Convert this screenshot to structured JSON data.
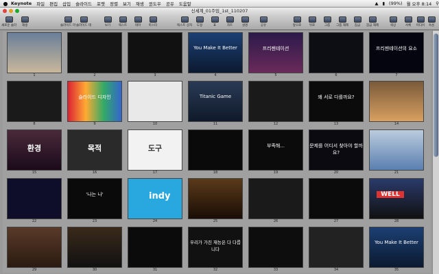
{
  "menubar": {
    "apple": "",
    "app_name": "Keynote",
    "menus": [
      "파일",
      "편집",
      "삽입",
      "슬라이드",
      "포맷",
      "정렬",
      "보기",
      "재생",
      "윈도우",
      "공유",
      "도움말"
    ],
    "battery": "(99%)",
    "clock": "월 오후 8:14"
  },
  "window": {
    "title": "신세계_01주임_1st_110207"
  },
  "toolbar": {
    "left": [
      "새로운 슬라이드",
      "재생",
      "슬라이드 마스터",
      "슬라이드 테마",
      "보기",
      "텍스트",
      "테마"
    ],
    "middle": [
      "마스터",
      "텍스트 상자",
      "도형",
      "표",
      "차트",
      "설명",
      "공유"
    ],
    "right": [
      "앞으로",
      "뒤로",
      "그룹",
      "그룹 해제",
      "잠금",
      "잠금 해제",
      "색상",
      "서체",
      "미디어",
      "속성"
    ]
  },
  "slides": [
    {
      "n": "1",
      "title": ""
    },
    {
      "n": "2",
      "title": ""
    },
    {
      "n": "3",
      "title": ""
    },
    {
      "n": "4",
      "title": "You Make It Better"
    },
    {
      "n": "5",
      "title": "프리젠테이션"
    },
    {
      "n": "6",
      "title": ""
    },
    {
      "n": "7",
      "title": "프리젠테이션의 요소"
    },
    {
      "n": "8",
      "title": ""
    },
    {
      "n": "9",
      "title": "슬라이드 디자인"
    },
    {
      "n": "10",
      "title": ""
    },
    {
      "n": "11",
      "title": "Titanic Game"
    },
    {
      "n": "12",
      "title": ""
    },
    {
      "n": "13",
      "title": "왜 서로 다를까요?"
    },
    {
      "n": "14",
      "title": ""
    },
    {
      "n": "15",
      "title": "환경"
    },
    {
      "n": "16",
      "title": "목적"
    },
    {
      "n": "17",
      "title": "도구"
    },
    {
      "n": "18",
      "title": ""
    },
    {
      "n": "19",
      "title": "부족해..."
    },
    {
      "n": "20",
      "title": "문제를 어디서 찾아야 할까요?"
    },
    {
      "n": "21",
      "title": ""
    },
    {
      "n": "22",
      "title": ""
    },
    {
      "n": "23",
      "title": "'나는 나'"
    },
    {
      "n": "24",
      "title": "indy"
    },
    {
      "n": "25",
      "title": ""
    },
    {
      "n": "26",
      "title": ""
    },
    {
      "n": "27",
      "title": ""
    },
    {
      "n": "28",
      "title": "WELL"
    },
    {
      "n": "29",
      "title": ""
    },
    {
      "n": "30",
      "title": ""
    },
    {
      "n": "31",
      "title": ""
    },
    {
      "n": "32",
      "title": "우리가 가진 재능은 다 다릅니다"
    },
    {
      "n": "33",
      "title": ""
    },
    {
      "n": "34",
      "title": ""
    },
    {
      "n": "35",
      "title": "You Make It Better"
    }
  ]
}
